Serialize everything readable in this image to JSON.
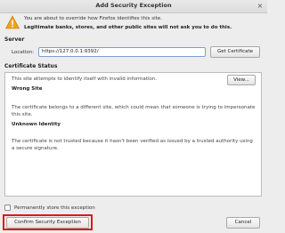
{
  "window": {
    "title": "Add Security Exception",
    "close_glyph": "×"
  },
  "warning": {
    "icon": "warning-icon",
    "line1": "You are about to override how Firefox identifies this site.",
    "line2": "Legitimate banks, stores, and other public sites will not ask you to do this."
  },
  "server": {
    "section_label": "Server",
    "location_label": "Location:",
    "location_value": "https://127.0.0.1:9392/",
    "get_certificate_label": "Get Certificate"
  },
  "certificate_status": {
    "section_label": "Certificate Status",
    "intro": "This site attempts to identify itself with invalid information.",
    "view_label": "View...",
    "wrong_site_heading": "Wrong Site",
    "wrong_site_text": "The certificate belongs to a different site, which could mean that someone is trying to impersonate this site.",
    "unknown_identity_heading": "Unknown Identity",
    "unknown_identity_text": "The certificate is not trusted because it hasn't been verified as issued by a trusted authority using a secure signature."
  },
  "permanent": {
    "label": "Permanently store this exception",
    "checked": false
  },
  "buttons": {
    "confirm_label": "Confirm Security Exception",
    "cancel_label": "Cancel"
  },
  "colors": {
    "highlight": "#e01818",
    "warning": "#f0a020"
  }
}
